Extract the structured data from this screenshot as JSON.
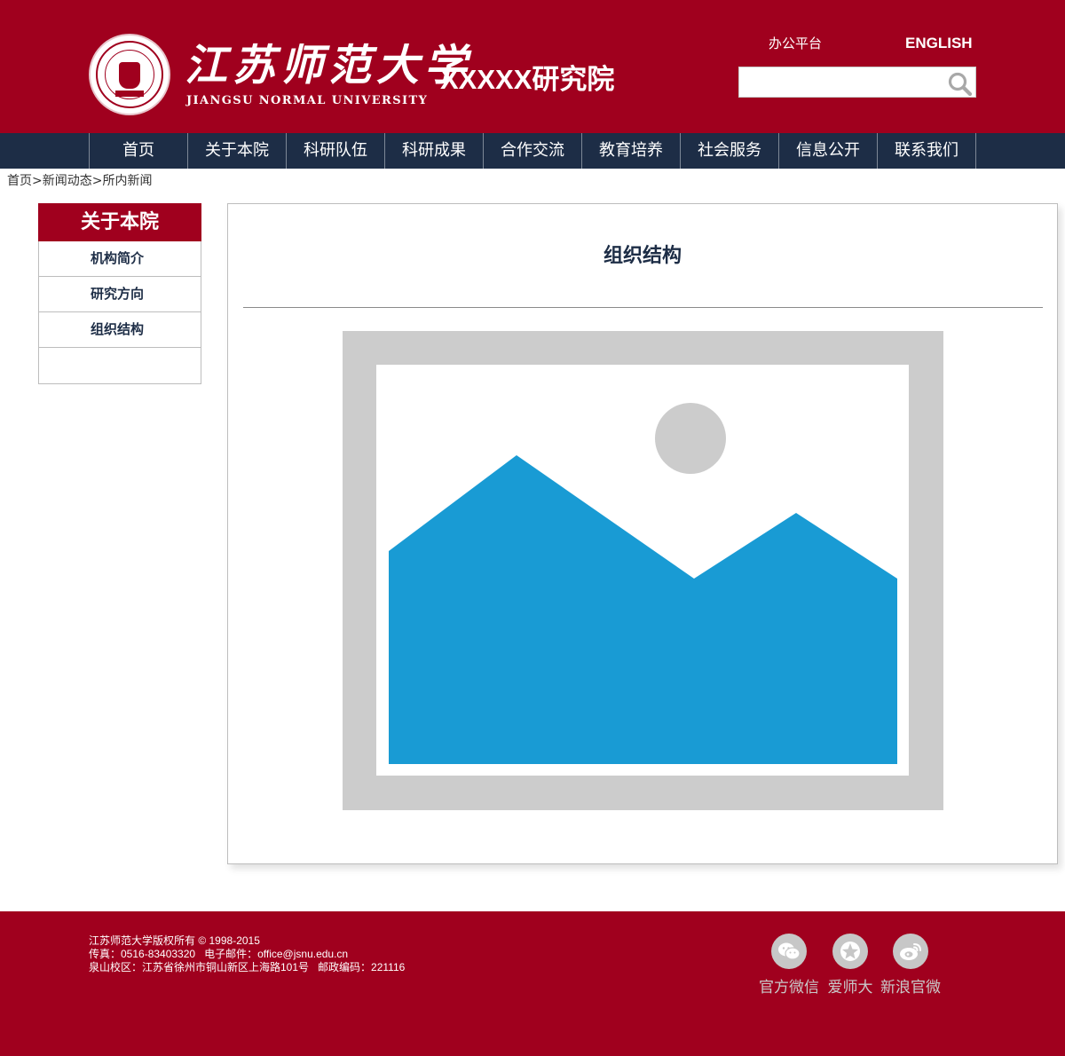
{
  "header": {
    "university_cn": "江苏师范大学",
    "university_en": "JIANGSU NORMAL UNIVERSITY",
    "institute": "XXXXX研究院",
    "office_platform": "办公平台",
    "english": "ENGLISH",
    "search": {
      "value": "",
      "placeholder": ""
    }
  },
  "nav": {
    "items": [
      "首页",
      "关于本院",
      "科研队伍",
      "科研成果",
      "合作交流",
      "教育培养",
      "社会服务",
      "信息公开",
      "联系我们"
    ]
  },
  "breadcrumb": "首页>新闻动态>所内新闻",
  "sidebar": {
    "title": "关于本院",
    "items": [
      "机构简介",
      "研究方向",
      "组织结构"
    ]
  },
  "content": {
    "title": "组织结构"
  },
  "footer": {
    "copyright": "江苏师范大学版权所有 © 1998-2015",
    "contact": "传真：0516-83403320   电子邮件：office@jsnu.edu.cn",
    "address": "泉山校区：江苏省徐州市铜山新区上海路101号   邮政编码：221116",
    "social": [
      {
        "label": "官方微信",
        "icon": "wechat-icon"
      },
      {
        "label": "爱师大",
        "icon": "aishida-icon"
      },
      {
        "label": "新浪官微",
        "icon": "weibo-icon"
      }
    ]
  },
  "colors": {
    "brand_red": "#a0001e",
    "nav_navy": "#1d2d46",
    "placeholder_blue": "#199bd4",
    "placeholder_gray": "#cccccc"
  }
}
